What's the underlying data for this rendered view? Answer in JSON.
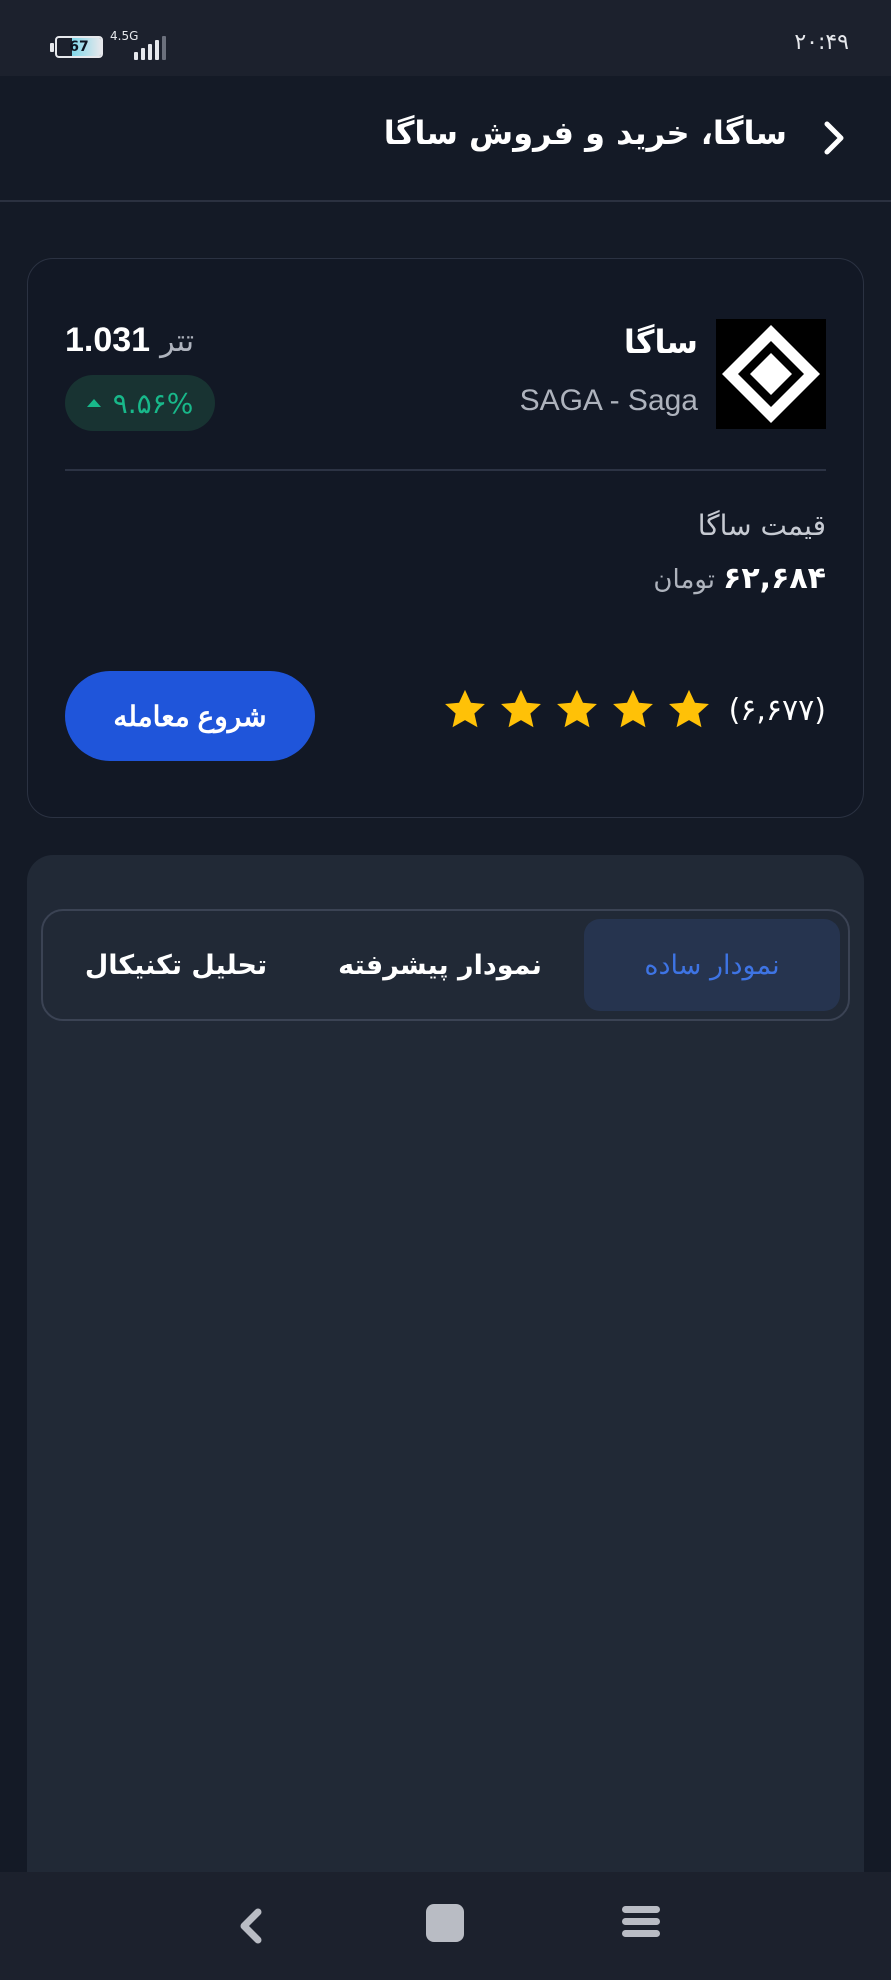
{
  "status_bar": {
    "time": "۲۰:۴۹",
    "battery": "67",
    "network": "4.5G"
  },
  "header": {
    "title": "ساگا، خرید و فروش ساگا",
    "back_icon": "chevron-right-icon"
  },
  "coin": {
    "name": "ساگا",
    "symbol": "SAGA - Saga",
    "logo_icon": "saga-logo-icon",
    "price_usdt": "1.031",
    "price_unit": "تتر",
    "change_percent": "۹.۵۶%",
    "change_direction": "up",
    "price_label": "قیمت ساگا",
    "price_toman": "۶۲,۶۸۴",
    "toman_unit": "تومان",
    "rating_count": "(۶,۶۷۷)",
    "rating_stars": 5,
    "trade_button": "شروع معامله"
  },
  "chart_tabs": [
    {
      "label": "نمودار ساده",
      "active": true
    },
    {
      "label": "نمودار پیشرفته",
      "active": false
    },
    {
      "label": "تحلیل تکنیکال",
      "active": false
    }
  ],
  "colors": {
    "background": "#141a26",
    "accent": "#1f55da",
    "positive": "#18b88a",
    "star": "#ffc107"
  },
  "nav": {
    "back_icon": "back-icon",
    "home_icon": "home-icon",
    "menu_icon": "menu-icon"
  }
}
